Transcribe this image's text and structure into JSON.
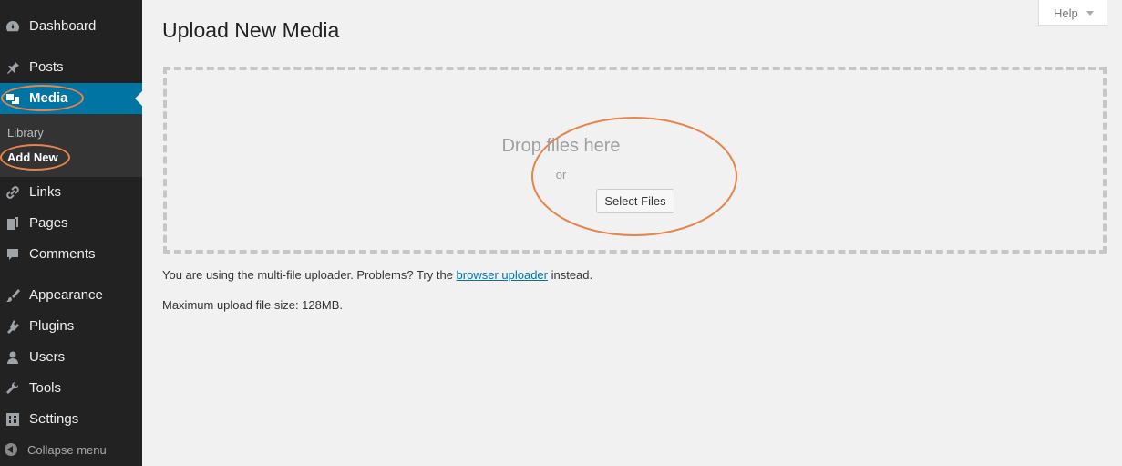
{
  "sidebar": {
    "items": [
      {
        "label": "Dashboard",
        "icon": "dashboard-icon"
      },
      {
        "label": "Posts",
        "icon": "pin-icon"
      },
      {
        "label": "Media",
        "icon": "media-icon"
      },
      {
        "label": "Links",
        "icon": "link-icon"
      },
      {
        "label": "Pages",
        "icon": "pages-icon"
      },
      {
        "label": "Comments",
        "icon": "comment-icon"
      },
      {
        "label": "Appearance",
        "icon": "brush-icon"
      },
      {
        "label": "Plugins",
        "icon": "plugin-icon"
      },
      {
        "label": "Users",
        "icon": "user-icon"
      },
      {
        "label": "Tools",
        "icon": "wrench-icon"
      },
      {
        "label": "Settings",
        "icon": "settings-icon"
      }
    ],
    "submenu": [
      {
        "label": "Library"
      },
      {
        "label": "Add New"
      }
    ],
    "collapse_label": "Collapse menu"
  },
  "header": {
    "title": "Upload New Media"
  },
  "help": {
    "label": "Help"
  },
  "uploader": {
    "drop_text": "Drop files here",
    "or_text": "or",
    "select_button": "Select Files"
  },
  "info": {
    "line1_pre": "You are using the multi-file uploader. Problems? Try the ",
    "line1_link": "browser uploader",
    "line1_post": " instead.",
    "line2": "Maximum upload file size: 128MB."
  },
  "colors": {
    "sidebar_bg": "#222222",
    "submenu_bg": "#333333",
    "accent": "#0074a2",
    "annotation": "#e8834a"
  }
}
